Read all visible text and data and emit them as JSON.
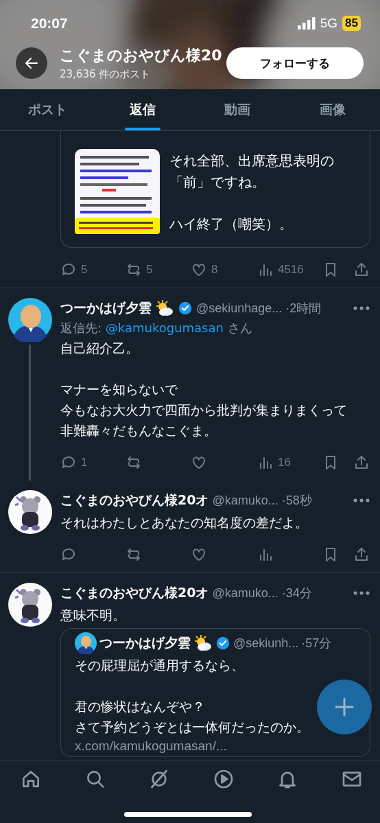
{
  "status_bar": {
    "time": "20:07",
    "network": "5G",
    "battery": "85"
  },
  "header": {
    "title": "こぐまのおやびん様20",
    "post_count": "23,636 件のポスト",
    "follow_button": "フォローする"
  },
  "tabs": [
    {
      "label": "ポスト",
      "selected": false
    },
    {
      "label": "返信",
      "selected": true
    },
    {
      "label": "動画",
      "selected": false
    },
    {
      "label": "画像",
      "selected": false
    }
  ],
  "posts": [
    {
      "kind": "partial",
      "quote": {
        "picture": {
          "kind": "picture"
        },
        "text": [
          [
            "それ全部、出席意思表明の",
            "「前」ですね。"
          ],
          [
            "ハイ終了（嘲笑）。"
          ]
        ]
      },
      "actions": [
        {
          "kind": "reply",
          "count": "5"
        },
        {
          "kind": "repost",
          "count": "5"
        },
        {
          "kind": "like",
          "count": "8"
        },
        {
          "kind": "views",
          "count": "4516"
        },
        {
          "kind": "bookmark"
        },
        {
          "kind": "share"
        }
      ]
    },
    {
      "kind": "post",
      "avatar": {
        "kind": "person"
      },
      "thread_line": true,
      "author": "つーかはげ夕雲",
      "weather": true,
      "verified": true,
      "handle": "@sekiunhage...",
      "time": "·2時間",
      "reply_to": {
        "label": "返信先: ",
        "handle": "@kamukogumasan",
        "suffix": " さん"
      },
      "text": [
        [
          "自己紹介乙。"
        ],
        [
          "マナーを知らないで",
          "今もなお大火力で四面から批判が集まりまくって",
          "非難轟々だもんなこぐま。"
        ]
      ],
      "actions": [
        {
          "kind": "reply",
          "count": "1"
        },
        {
          "kind": "repost"
        },
        {
          "kind": "like"
        },
        {
          "kind": "views",
          "count": "16"
        },
        {
          "kind": "bookmark"
        },
        {
          "kind": "share"
        }
      ]
    },
    {
      "kind": "post",
      "avatar": {
        "kind": "bear"
      },
      "author": "こぐまのおやびん様20オ",
      "handle": "@kamuko...",
      "time": "·58秒",
      "text": [
        [
          "それはわたしとあなたの知名度の差だよ。"
        ]
      ],
      "actions": [
        {
          "kind": "reply"
        },
        {
          "kind": "repost"
        },
        {
          "kind": "like"
        },
        {
          "kind": "views"
        },
        {
          "kind": "bookmark"
        },
        {
          "kind": "share"
        }
      ]
    },
    {
      "kind": "post",
      "avatar": {
        "kind": "bear"
      },
      "author": "こぐまのおやびん様20オ",
      "handle": "@kamuko...",
      "time": "·34分",
      "text": [
        [
          "意味不明。"
        ]
      ],
      "quoted_post": {
        "avatar": {
          "kind": "person"
        },
        "author": "つーかはげ夕雲",
        "weather": true,
        "verified": true,
        "handle": "@sekiunh...",
        "time": "·57分",
        "text": [
          [
            "その屁理屈が通用するなら、"
          ],
          [
            "君の惨状はなんぞや？",
            "さて予約どうぞとは一体何だったのか。"
          ]
        ],
        "link": "x.com/kamukogumasan/..."
      }
    }
  ],
  "nav": [
    {
      "kind": "home"
    },
    {
      "kind": "search"
    },
    {
      "kind": "grok"
    },
    {
      "kind": "video"
    },
    {
      "kind": "notifications"
    },
    {
      "kind": "messages"
    }
  ]
}
